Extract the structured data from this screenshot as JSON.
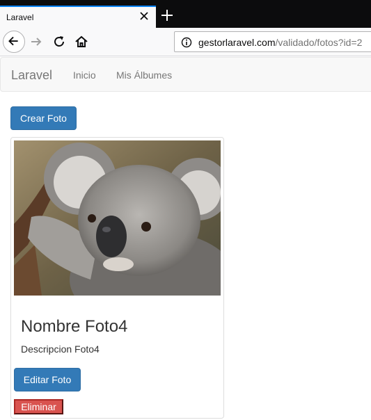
{
  "browser": {
    "tab_title": "Laravel",
    "url_domain": "gestorlaravel.com",
    "url_path": "/validado/fotos?id=2"
  },
  "navbar": {
    "brand": "Laravel",
    "links": [
      "Inicio",
      "Mis Álbumes"
    ]
  },
  "actions": {
    "create_label": "Crear Foto"
  },
  "photo_card": {
    "image_subject": "koala",
    "title": "Nombre Foto4",
    "description": "Descripcion Foto4",
    "edit_label": "Editar Foto",
    "delete_label": "Eliminar"
  },
  "colors": {
    "primary": "#337ab7",
    "danger": "#d9534f",
    "tab_accent": "#0a84ff"
  }
}
